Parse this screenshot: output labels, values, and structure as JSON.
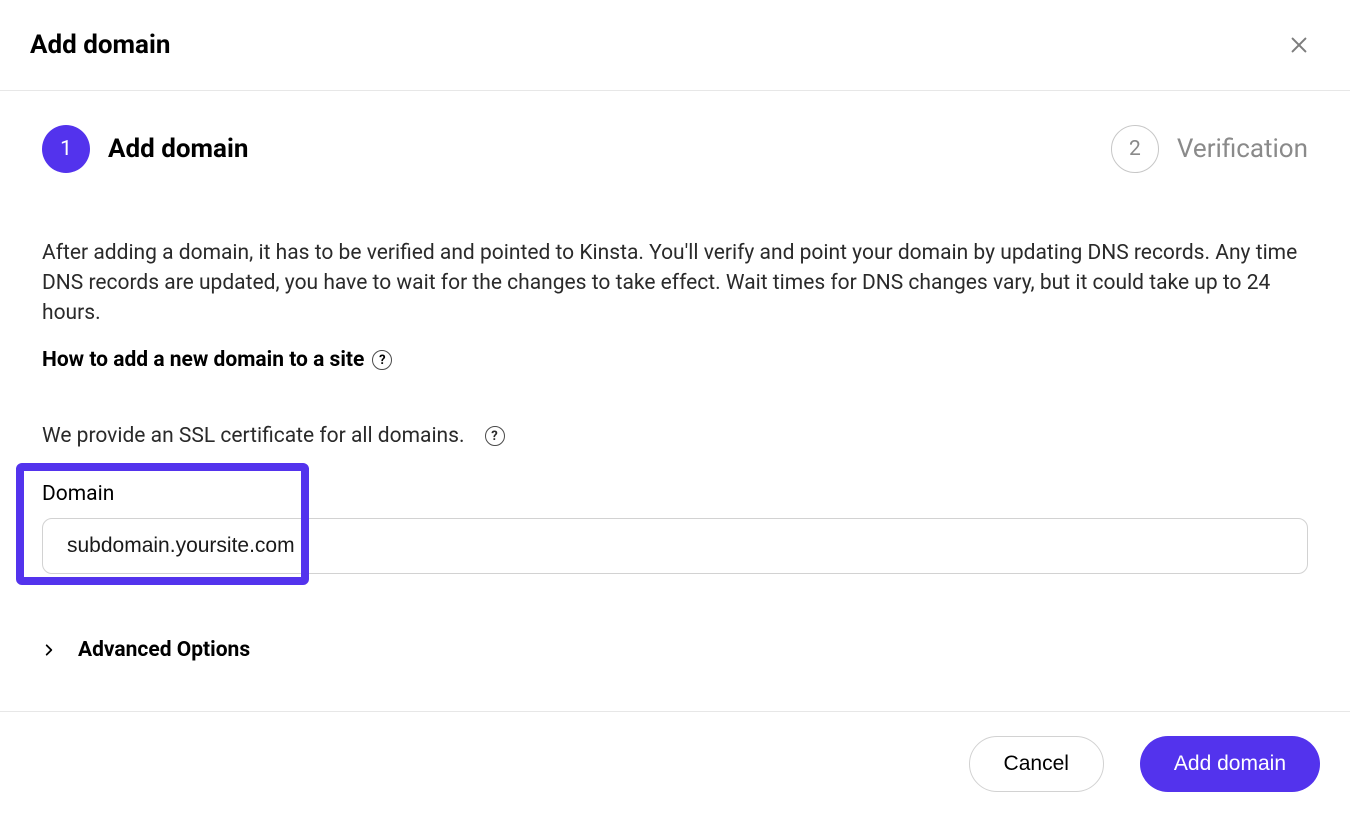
{
  "header": {
    "title": "Add domain"
  },
  "steps": {
    "one": {
      "num": "1",
      "label": "Add domain"
    },
    "two": {
      "num": "2",
      "label": "Verification"
    }
  },
  "body": {
    "intro": "After adding a domain, it has to be verified and pointed to Kinsta. You'll verify and point your domain by updating DNS records. Any time DNS records are updated, you have to wait for the changes to take effect. Wait times for DNS changes vary, but it could take up to 24 hours.",
    "help_link": "How to add a new domain to a site",
    "ssl_note": "We provide an SSL certificate for all domains."
  },
  "form": {
    "domain_label": "Domain",
    "domain_value": "subdomain.yoursite.com",
    "advanced_label": "Advanced Options"
  },
  "footer": {
    "cancel": "Cancel",
    "submit": "Add domain"
  },
  "colors": {
    "accent": "#5333ed"
  }
}
